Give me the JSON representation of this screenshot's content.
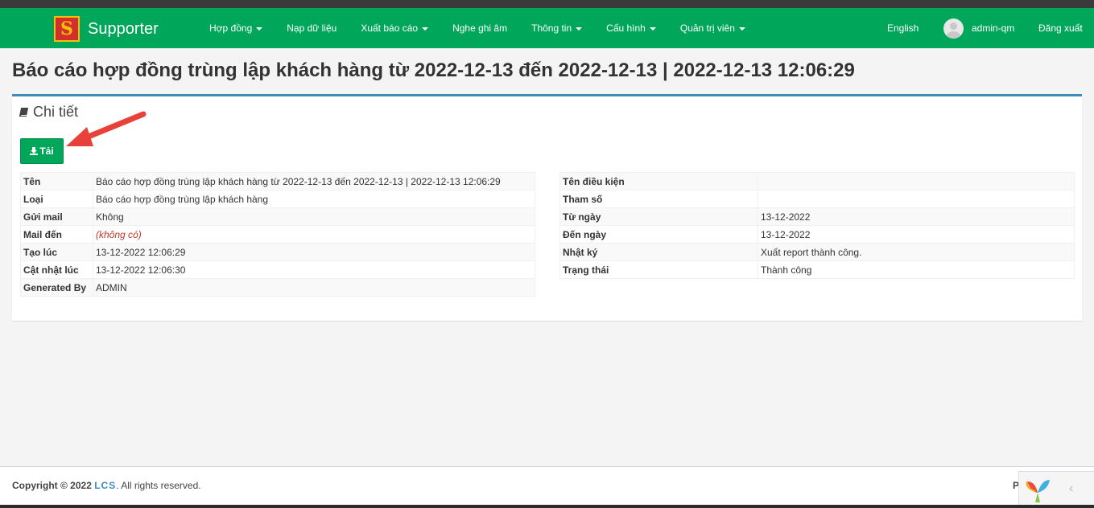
{
  "app": {
    "brand_name": "Supporter",
    "logo_letter": "S"
  },
  "navbar": {
    "menu": [
      {
        "label": "Hợp đồng",
        "dropdown": true
      },
      {
        "label": "Nạp dữ liệu",
        "dropdown": false
      },
      {
        "label": "Xuất báo cáo",
        "dropdown": true
      },
      {
        "label": "Nghe ghi âm",
        "dropdown": false
      },
      {
        "label": "Thông tin",
        "dropdown": true
      },
      {
        "label": "Cấu hình",
        "dropdown": true
      },
      {
        "label": "Quản trị viên",
        "dropdown": true
      }
    ],
    "language": "English",
    "username": "admin-qm",
    "logout": "Đăng xuất"
  },
  "page": {
    "title": "Báo cáo hợp đồng trùng lập khách hàng từ 2022-12-13 đến 2022-12-13 | 2022-12-13 12:06:29"
  },
  "panel": {
    "title": "Chi tiết",
    "download_label": "Tải"
  },
  "details_left": [
    {
      "label": "Tên",
      "value": "Báo cáo hợp đồng trùng lập khách hàng từ 2022-12-13 đến 2022-12-13 | 2022-12-13 12:06:29"
    },
    {
      "label": "Loại",
      "value": "Báo cáo hợp đồng trùng lập khách hàng"
    },
    {
      "label": "Gửi mail",
      "value": "Không"
    },
    {
      "label": "Mail đến",
      "value": "(không có)"
    },
    {
      "label": "Tạo lúc",
      "value": "13-12-2022 12:06:29"
    },
    {
      "label": "Cật nhật lúc",
      "value": "13-12-2022 12:06:30"
    },
    {
      "label": "Generated By",
      "value": "ADMIN"
    }
  ],
  "details_right": [
    {
      "label": "Tên điều kiện",
      "value": ""
    },
    {
      "label": "Tham số",
      "value": ""
    },
    {
      "label": "Từ ngày",
      "value": "13-12-2022"
    },
    {
      "label": "Đến ngày",
      "value": "13-12-2022"
    },
    {
      "label": "Nhật ký",
      "value": "Xuất report thành công."
    },
    {
      "label": "Trạng thái",
      "value": "Thành công"
    }
  ],
  "footer": {
    "copyright_prefix": "Copyright © 2022",
    "company_link": "LCS",
    "copyright_suffix": ". All rights reserved.",
    "right_text": "P"
  },
  "colors": {
    "navbar": "#00a65a",
    "panel_border": "#3c8dbc",
    "arrow": "#e8413a"
  }
}
